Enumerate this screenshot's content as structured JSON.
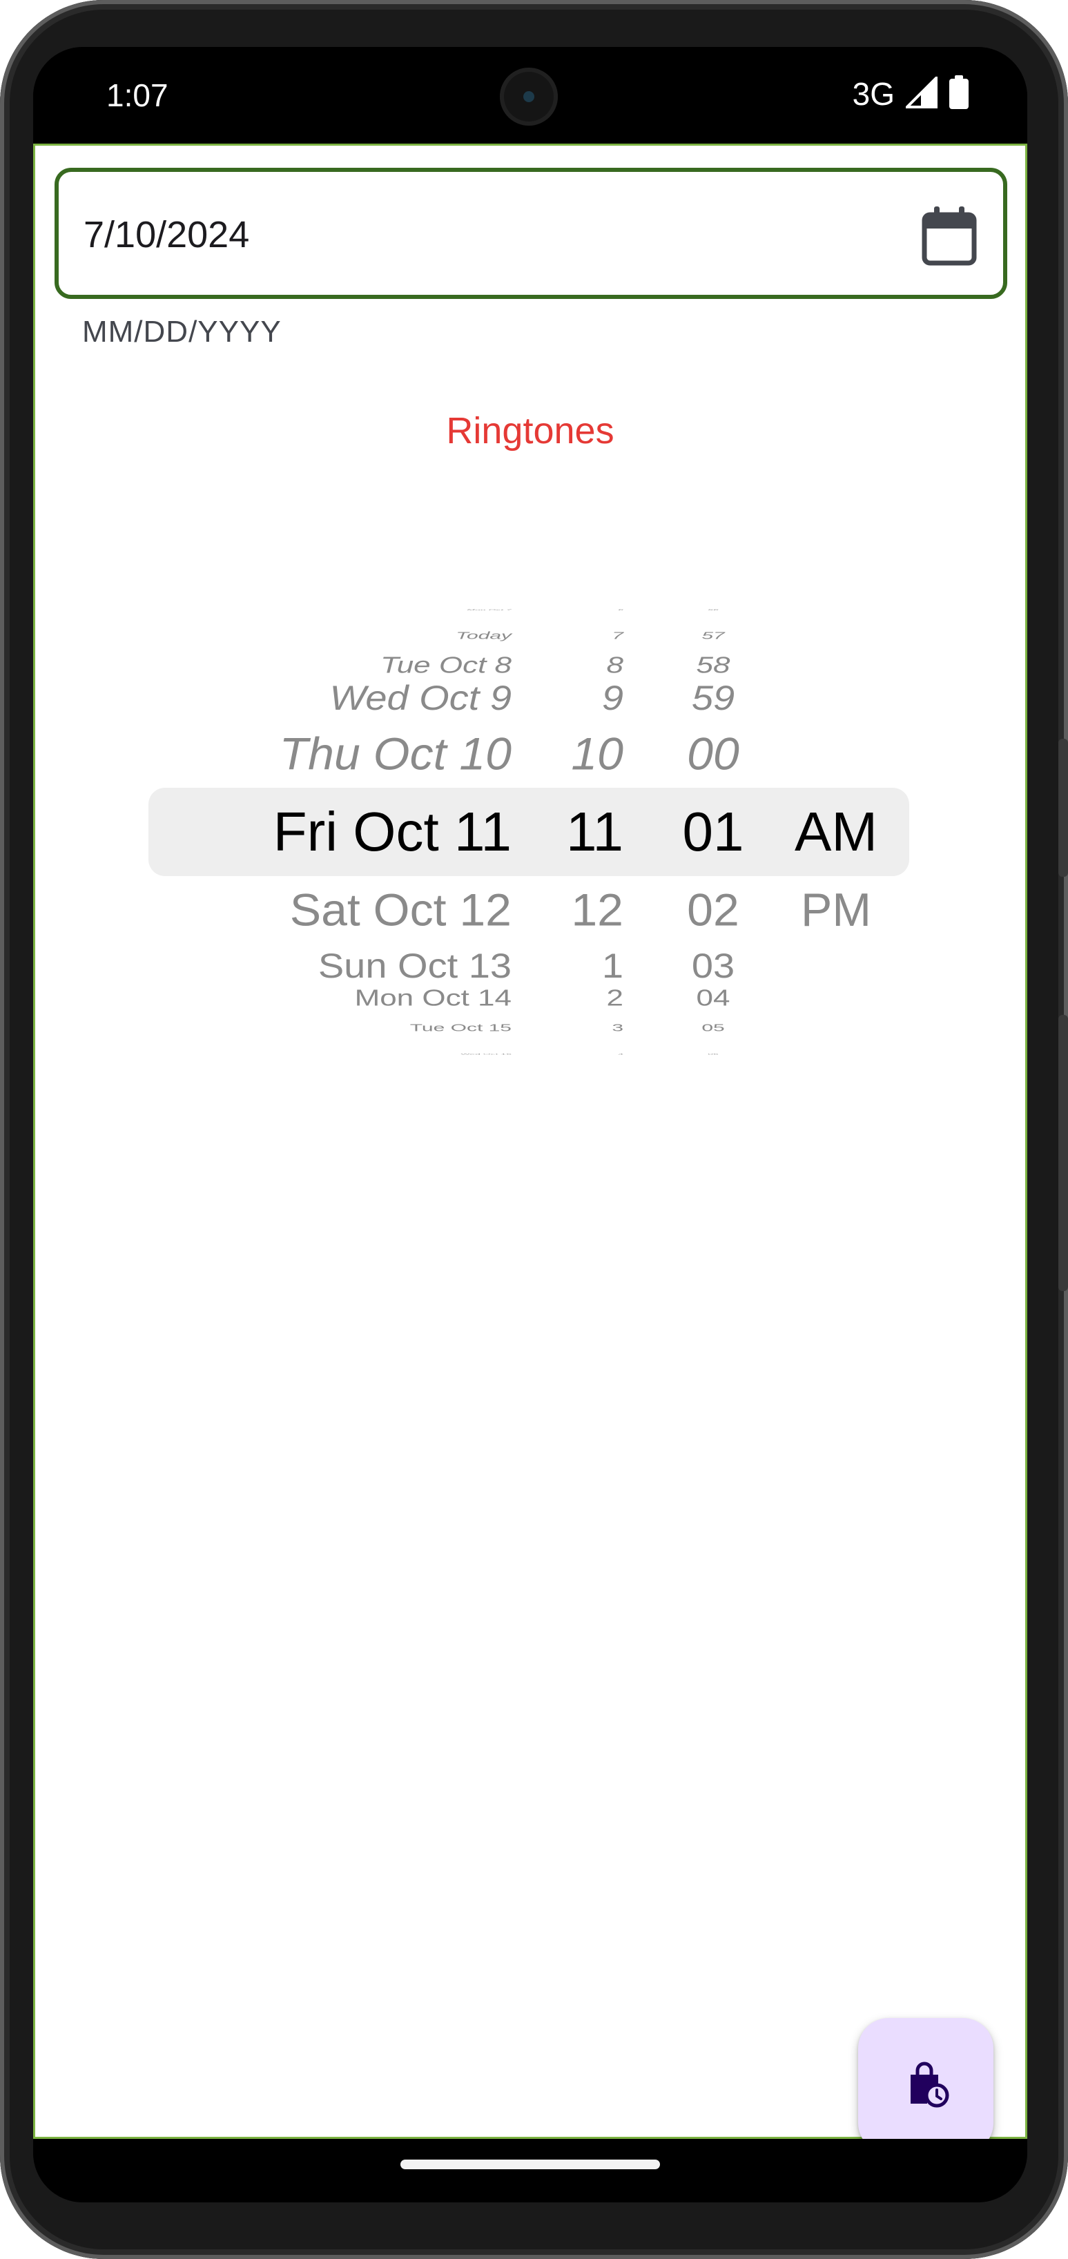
{
  "status_bar": {
    "time": "1:07",
    "network": "3G",
    "icons": [
      "signal-icon",
      "battery-icon"
    ]
  },
  "date_field": {
    "value": "7/10/2024",
    "hint": "MM/DD/YYYY",
    "icon": "calendar-icon",
    "border_color": "#386a20"
  },
  "heading": {
    "text": "Ringtones",
    "color": "#e53935"
  },
  "picker": {
    "days": [
      "Mon Oct 7",
      "Today",
      "Tue Oct 8",
      "Wed Oct 9",
      "Thu Oct 10",
      "Fri Oct 11",
      "Sat Oct 12",
      "Sun Oct 13",
      "Mon Oct 14",
      "Tue Oct 15",
      "Wed Oct 16"
    ],
    "hours": [
      "6",
      "7",
      "8",
      "9",
      "10",
      "11",
      "12",
      "1",
      "2",
      "3",
      "4"
    ],
    "minutes": [
      "56",
      "57",
      "58",
      "59",
      "00",
      "01",
      "02",
      "03",
      "04",
      "05",
      "06"
    ],
    "periods": [
      "AM",
      "PM"
    ],
    "selected": {
      "day": "Fri Oct 11",
      "hour": "11",
      "minute": "01",
      "period": "AM"
    }
  },
  "fab": {
    "icon": "shopping-bag-clock-icon",
    "background": "#eaddff"
  },
  "colors": {
    "app_border": "#7cb342",
    "highlight": "#eeeeee"
  }
}
